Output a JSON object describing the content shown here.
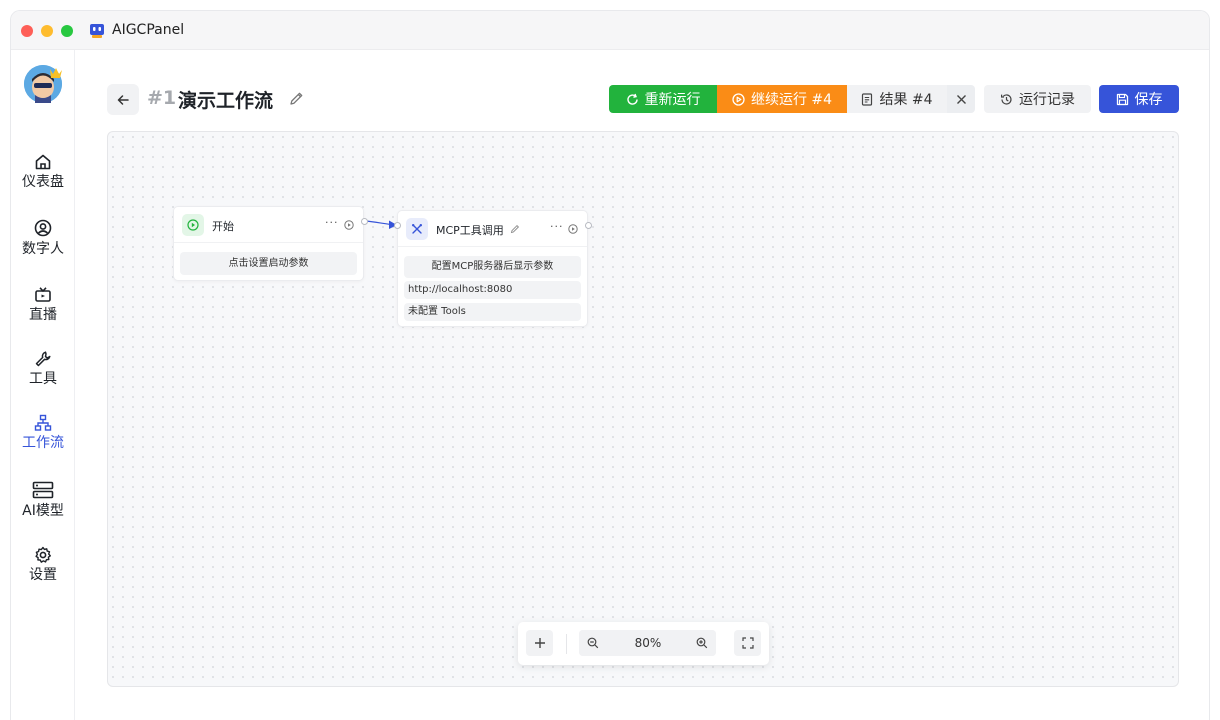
{
  "app": {
    "title": "AIGCPanel"
  },
  "sidebar": {
    "items": [
      {
        "label": "仪表盘",
        "icon": "home-icon"
      },
      {
        "label": "数字人",
        "icon": "user-circle-icon"
      },
      {
        "label": "直播",
        "icon": "tv-icon"
      },
      {
        "label": "工具",
        "icon": "wrench-icon"
      },
      {
        "label": "工作流",
        "icon": "workflow-icon",
        "active": true
      },
      {
        "label": "AI模型",
        "icon": "server-icon"
      },
      {
        "label": "设置",
        "icon": "gear-icon"
      }
    ]
  },
  "header": {
    "number": "#1",
    "title": "演示工作流",
    "rerun_label": "重新运行",
    "continue_label": "继续运行 #4",
    "result_label": "结果 #4",
    "history_label": "运行记录",
    "save_label": "保存"
  },
  "nodes": {
    "start": {
      "title": "开始",
      "more": "···",
      "param": "点击设置启动参数"
    },
    "mcp": {
      "title": "MCP工具调用",
      "more": "···",
      "param": "配置MCP服务器后显示参数",
      "url": "http://localhost:8080",
      "tools": "未配置 Tools"
    }
  },
  "toolbar": {
    "zoom": "80%"
  },
  "colors": {
    "accent": "#3654d9",
    "rerun": "#22b33d",
    "continue": "#fa8c16",
    "edge": "#3654d9"
  }
}
